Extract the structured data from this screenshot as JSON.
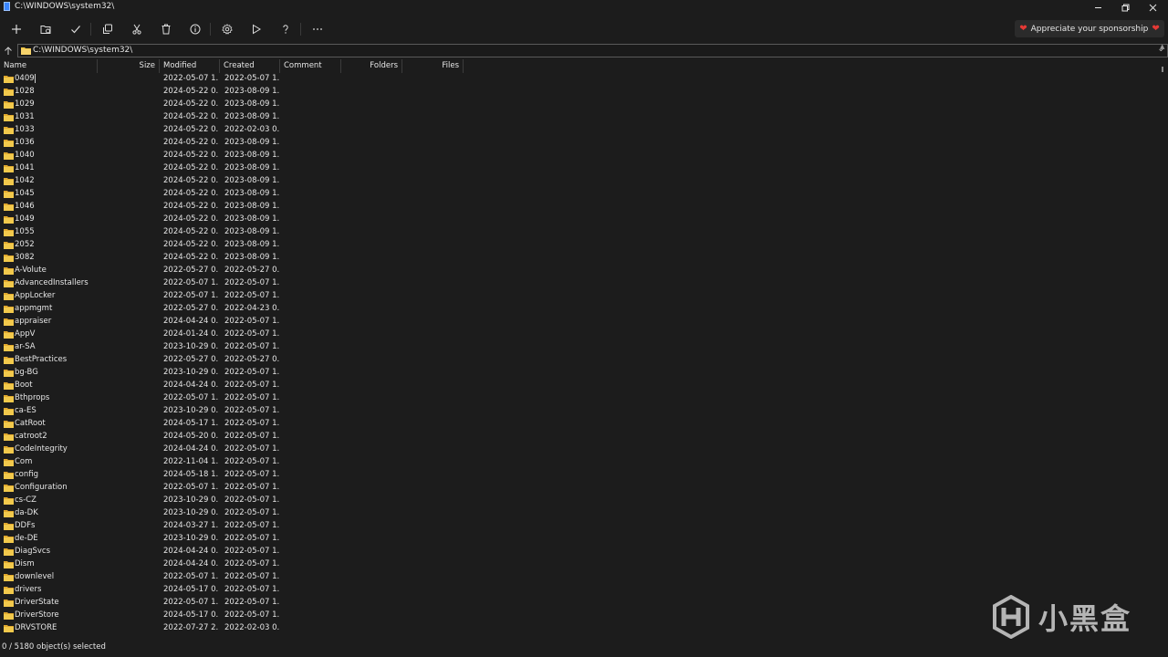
{
  "window": {
    "title": "C:\\WINDOWS\\system32\\",
    "controls": [
      "minimize",
      "restore",
      "close"
    ]
  },
  "toolbar": {
    "buttons": [
      {
        "name": "new-button",
        "icon": "plus-icon"
      },
      {
        "name": "new-folder-button",
        "icon": "folder-add-icon"
      },
      {
        "name": "select-button",
        "icon": "checkmark-icon"
      },
      {
        "name": "copy-button",
        "icon": "copy-icon"
      },
      {
        "name": "cut-button",
        "icon": "scissors-icon"
      },
      {
        "name": "delete-button",
        "icon": "trash-icon"
      },
      {
        "name": "properties-button",
        "icon": "info-icon"
      },
      {
        "name": "settings-button",
        "icon": "gear-icon"
      },
      {
        "name": "run-button",
        "icon": "play-icon"
      },
      {
        "name": "help-button",
        "icon": "question-icon"
      },
      {
        "name": "more-button",
        "icon": "ellipsis-icon"
      }
    ],
    "sponsor_label": "Appreciate your sponsorship"
  },
  "address": {
    "path": "C:\\WINDOWS\\system32\\"
  },
  "columns": {
    "name": "Name",
    "size": "Size",
    "modified": "Modified",
    "created": "Created",
    "comment": "Comment",
    "folders": "Folders",
    "files": "Files"
  },
  "files": [
    {
      "name": "0409",
      "modified": "2022-05-07 1...",
      "created": "2022-05-07 1..."
    },
    {
      "name": "1028",
      "modified": "2024-05-22 0...",
      "created": "2023-08-09 1..."
    },
    {
      "name": "1029",
      "modified": "2024-05-22 0...",
      "created": "2023-08-09 1..."
    },
    {
      "name": "1031",
      "modified": "2024-05-22 0...",
      "created": "2023-08-09 1..."
    },
    {
      "name": "1033",
      "modified": "2024-05-22 0...",
      "created": "2022-02-03 0..."
    },
    {
      "name": "1036",
      "modified": "2024-05-22 0...",
      "created": "2023-08-09 1..."
    },
    {
      "name": "1040",
      "modified": "2024-05-22 0...",
      "created": "2023-08-09 1..."
    },
    {
      "name": "1041",
      "modified": "2024-05-22 0...",
      "created": "2023-08-09 1..."
    },
    {
      "name": "1042",
      "modified": "2024-05-22 0...",
      "created": "2023-08-09 1..."
    },
    {
      "name": "1045",
      "modified": "2024-05-22 0...",
      "created": "2023-08-09 1..."
    },
    {
      "name": "1046",
      "modified": "2024-05-22 0...",
      "created": "2023-08-09 1..."
    },
    {
      "name": "1049",
      "modified": "2024-05-22 0...",
      "created": "2023-08-09 1..."
    },
    {
      "name": "1055",
      "modified": "2024-05-22 0...",
      "created": "2023-08-09 1..."
    },
    {
      "name": "2052",
      "modified": "2024-05-22 0...",
      "created": "2023-08-09 1..."
    },
    {
      "name": "3082",
      "modified": "2024-05-22 0...",
      "created": "2023-08-09 1..."
    },
    {
      "name": "A-Volute",
      "modified": "2022-05-27 0...",
      "created": "2022-05-27 0..."
    },
    {
      "name": "AdvancedInstallers",
      "modified": "2022-05-07 1...",
      "created": "2022-05-07 1..."
    },
    {
      "name": "AppLocker",
      "modified": "2022-05-07 1...",
      "created": "2022-05-07 1..."
    },
    {
      "name": "appmgmt",
      "modified": "2022-05-27 0...",
      "created": "2022-04-23 0..."
    },
    {
      "name": "appraiser",
      "modified": "2024-04-24 0...",
      "created": "2022-05-07 1..."
    },
    {
      "name": "AppV",
      "modified": "2024-01-24 0...",
      "created": "2022-05-07 1..."
    },
    {
      "name": "ar-SA",
      "modified": "2023-10-29 0...",
      "created": "2022-05-07 1..."
    },
    {
      "name": "BestPractices",
      "modified": "2022-05-27 0...",
      "created": "2022-05-27 0..."
    },
    {
      "name": "bg-BG",
      "modified": "2023-10-29 0...",
      "created": "2022-05-07 1..."
    },
    {
      "name": "Boot",
      "modified": "2024-04-24 0...",
      "created": "2022-05-07 1..."
    },
    {
      "name": "Bthprops",
      "modified": "2022-05-07 1...",
      "created": "2022-05-07 1..."
    },
    {
      "name": "ca-ES",
      "modified": "2023-10-29 0...",
      "created": "2022-05-07 1..."
    },
    {
      "name": "CatRoot",
      "modified": "2024-05-17 1...",
      "created": "2022-05-07 1..."
    },
    {
      "name": "catroot2",
      "modified": "2024-05-20 0...",
      "created": "2022-05-07 1..."
    },
    {
      "name": "CodeIntegrity",
      "modified": "2024-04-24 0...",
      "created": "2022-05-07 1..."
    },
    {
      "name": "Com",
      "modified": "2022-11-04 1...",
      "created": "2022-05-07 1..."
    },
    {
      "name": "config",
      "modified": "2024-05-18 1...",
      "created": "2022-05-07 1..."
    },
    {
      "name": "Configuration",
      "modified": "2022-05-07 1...",
      "created": "2022-05-07 1..."
    },
    {
      "name": "cs-CZ",
      "modified": "2023-10-29 0...",
      "created": "2022-05-07 1..."
    },
    {
      "name": "da-DK",
      "modified": "2023-10-29 0...",
      "created": "2022-05-07 1..."
    },
    {
      "name": "DDFs",
      "modified": "2024-03-27 1...",
      "created": "2022-05-07 1..."
    },
    {
      "name": "de-DE",
      "modified": "2023-10-29 0...",
      "created": "2022-05-07 1..."
    },
    {
      "name": "DiagSvcs",
      "modified": "2024-04-24 0...",
      "created": "2022-05-07 1..."
    },
    {
      "name": "Dism",
      "modified": "2024-04-24 0...",
      "created": "2022-05-07 1..."
    },
    {
      "name": "downlevel",
      "modified": "2022-05-07 1...",
      "created": "2022-05-07 1..."
    },
    {
      "name": "drivers",
      "modified": "2024-05-17 0...",
      "created": "2022-05-07 1..."
    },
    {
      "name": "DriverState",
      "modified": "2022-05-07 1...",
      "created": "2022-05-07 1..."
    },
    {
      "name": "DriverStore",
      "modified": "2024-05-17 0...",
      "created": "2022-05-07 1..."
    },
    {
      "name": "DRVSTORE",
      "modified": "2022-07-27 2...",
      "created": "2022-02-03 0..."
    }
  ],
  "status": {
    "text": "0 / 5180 object(s) selected"
  },
  "watermark": {
    "text": "小黑盒"
  },
  "colors": {
    "background": "#1c1c1c",
    "folder": "#f2c94c",
    "heart": "#e53935",
    "text": "#e6e6e6"
  }
}
